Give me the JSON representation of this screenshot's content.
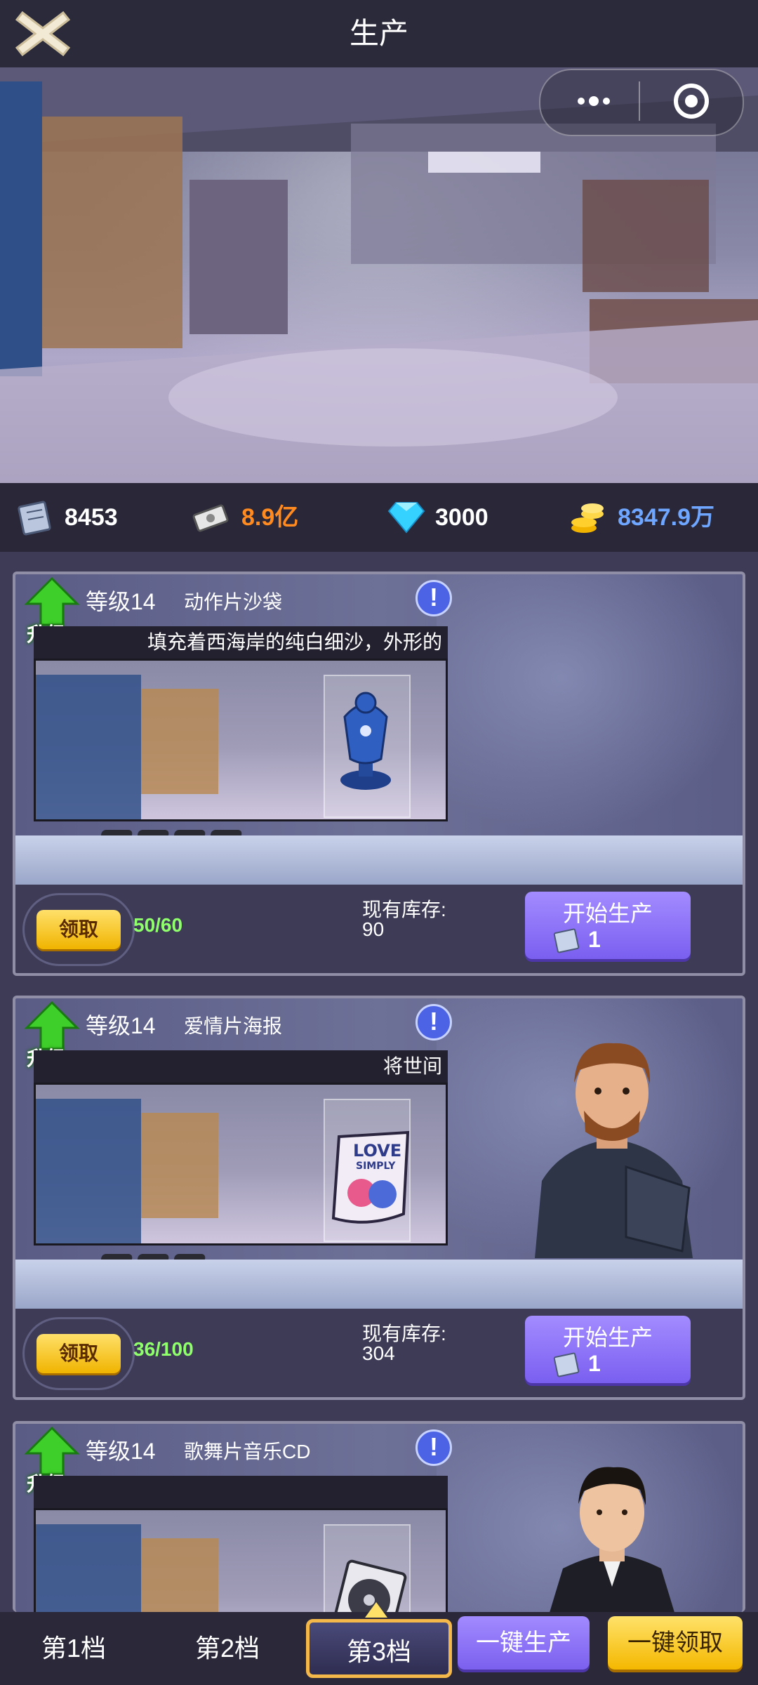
{
  "header": {
    "title": "生产"
  },
  "resources": [
    {
      "icon": "blueprint-icon",
      "value": "8453",
      "color": "#ffffff"
    },
    {
      "icon": "money-icon",
      "value": "8.9亿",
      "color": "#ff8a1f"
    },
    {
      "icon": "diamond-icon",
      "value": "3000",
      "color": "#ffffff"
    },
    {
      "icon": "gold-coins-icon",
      "value": "8347.9万",
      "color": "#6fa6ff"
    }
  ],
  "cards": [
    {
      "level": "等级14",
      "name": "动作片沙袋",
      "upgrade": "升级",
      "description": "填充着西海岸的纯白细沙，外形的",
      "claim": "领取",
      "progress": "50/60",
      "stock_label": "现有库存:",
      "stock_value": "90",
      "produce_label": "开始生产",
      "produce_cost": "1",
      "tokens": 4
    },
    {
      "level": "等级14",
      "name": "爱情片海报",
      "upgrade": "升级",
      "description": "将世间",
      "claim": "领取",
      "progress": "36/100",
      "stock_label": "现有库存:",
      "stock_value": "304",
      "produce_label": "开始生产",
      "produce_cost": "1",
      "tokens": 3
    },
    {
      "level": "等级14",
      "name": "歌舞片音乐CD",
      "upgrade": "升级",
      "description": ""
    }
  ],
  "poster_text": {
    "line1": "LOVE",
    "line2": "SIMPLY"
  },
  "tabs": [
    {
      "label": "第1档",
      "active": false
    },
    {
      "label": "第2档",
      "active": false
    },
    {
      "label": "第3档",
      "active": true
    }
  ],
  "actions": {
    "produce_all": "一键生产",
    "claim_all": "一键领取"
  },
  "colors": {
    "accent_purple": "#8a70f6",
    "accent_yellow": "#f8c21a",
    "progress_green": "#8fff6b"
  }
}
